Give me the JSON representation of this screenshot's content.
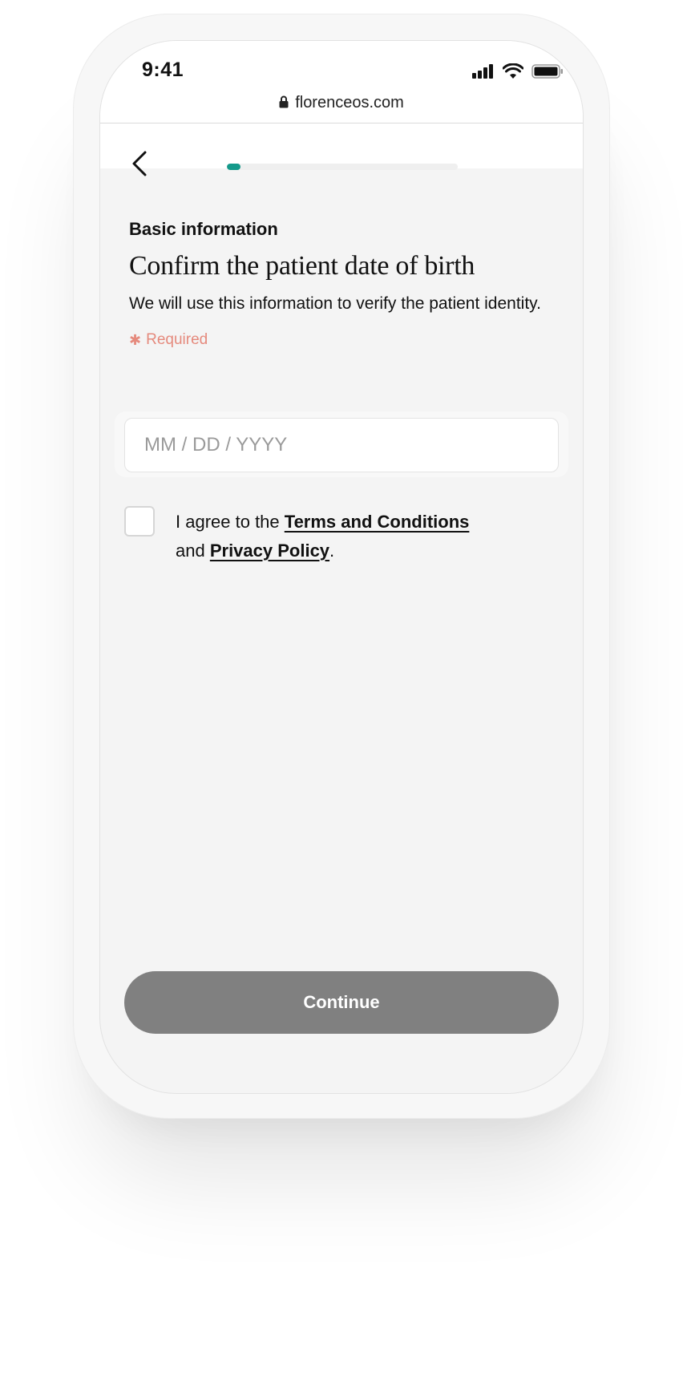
{
  "status_bar": {
    "time": "9:41"
  },
  "browser": {
    "url": "florenceos.com"
  },
  "progress": {
    "value": 0.06
  },
  "header": {
    "back_icon": "chevron-left-icon"
  },
  "form": {
    "kicker": "Basic information",
    "title": "Confirm the patient date of birth",
    "description": "We will use this information to verify the patient identity.",
    "required_label": "Required",
    "date_placeholder": "MM / DD / YYYY",
    "date_value": ""
  },
  "agreement": {
    "prefix": "I agree to the ",
    "terms_label": "Terms and Conditions",
    "middle": "and ",
    "privacy_label": "Privacy Policy",
    "suffix": "."
  },
  "actions": {
    "continue_label": "Continue"
  },
  "colors": {
    "accent": "#14998a",
    "required": "#e58a7d",
    "button_disabled": "#808080",
    "page_bg": "#f4f4f4"
  }
}
